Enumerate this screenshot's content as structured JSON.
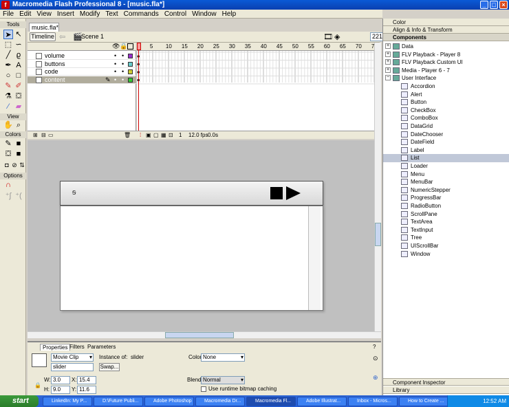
{
  "window": {
    "title": "Macromedia Flash Professional 8 - [music.fla*]"
  },
  "menu": [
    "File",
    "Edit",
    "View",
    "Insert",
    "Modify",
    "Text",
    "Commands",
    "Control",
    "Window",
    "Help"
  ],
  "tools": {
    "tools_label": "Tools",
    "view_label": "View",
    "colors_label": "Colors",
    "options_label": "Options"
  },
  "document": {
    "tab": "music.fla*",
    "timeline_button": "Timeline",
    "scene": "Scene 1",
    "zoom": "221%"
  },
  "layers": [
    {
      "name": "volume",
      "color": "#9933cc"
    },
    {
      "name": "buttons",
      "color": "#66cccc"
    },
    {
      "name": "code",
      "color": "#cccc33"
    },
    {
      "name": "content",
      "color": "#33cc33"
    }
  ],
  "frame_numbers": [
    "1",
    "5",
    "10",
    "15",
    "20",
    "25",
    "30",
    "35",
    "40",
    "45",
    "50",
    "55",
    "60",
    "65",
    "70",
    "75"
  ],
  "timeline_status": {
    "frame": "1",
    "fps": "12.0 fps",
    "time": "0.0s"
  },
  "properties": {
    "tabs": [
      "Properties",
      "Filters",
      "Parameters"
    ],
    "symbol_type": "Movie Clip",
    "instance_of_label": "Instance of:",
    "instance_of": "slider",
    "instance_name": "slider",
    "swap_label": "Swap...",
    "color_label": "Color:",
    "color_value": "None",
    "w_label": "W:",
    "w": "3.0",
    "x_label": "X:",
    "x": "15.4",
    "h_label": "H:",
    "h": "9.0",
    "y_label": "Y:",
    "y": "11.6",
    "blend_label": "Blend:",
    "blend_value": "Normal",
    "cache_label": "Use runtime bitmap caching"
  },
  "right_panels": {
    "color": "Color",
    "align": "Align & Info & Transform",
    "components": "Components",
    "inspector": "Component Inspector",
    "library": "Library"
  },
  "component_groups": [
    "Data",
    "FLV Playback - Player 8",
    "FLV Playback Custom UI",
    "Media - Player 6 - 7",
    "User Interface"
  ],
  "ui_components": [
    "Accordion",
    "Alert",
    "Button",
    "CheckBox",
    "ComboBox",
    "DataGrid",
    "DateChooser",
    "DateField",
    "Label",
    "List",
    "Loader",
    "Menu",
    "MenuBar",
    "NumericStepper",
    "ProgressBar",
    "RadioButton",
    "ScrollPane",
    "TextArea",
    "TextInput",
    "Tree",
    "UIScrollBar",
    "Window"
  ],
  "selected_component": "List",
  "taskbar": {
    "start": "start",
    "tasks": [
      "LinkedIn: My P...",
      "D:\\Future Publi...",
      "Adobe Photoshop",
      "Macromedia Dr...",
      "Macromedia Fl...",
      "Adobe Illustrat...",
      "Inbox - Micros...",
      "How to Create ..."
    ],
    "active_task": "Macromedia Fl...",
    "clock": "12:52 AM"
  }
}
